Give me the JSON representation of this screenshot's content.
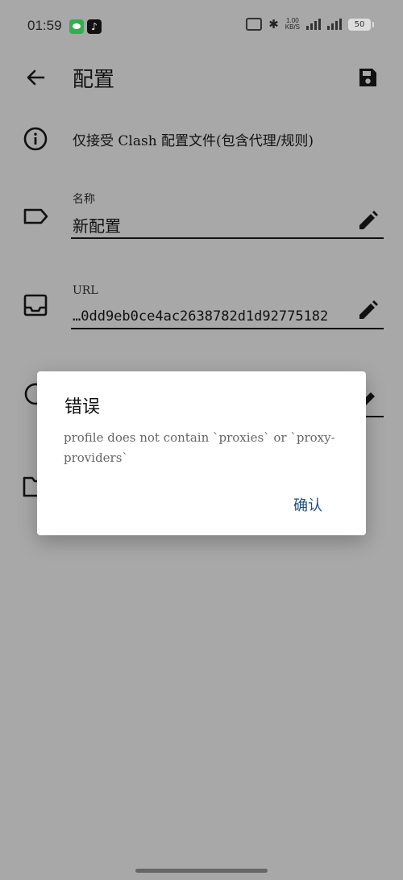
{
  "status_bar": {
    "time": "01:59",
    "net_speed_value": "1.00",
    "net_speed_unit": "KB/S",
    "battery": "50",
    "icons": [
      "wechat-icon",
      "tiktok-icon",
      "vibrate-icon",
      "bluetooth-icon",
      "signal-icon",
      "signal-icon",
      "battery-icon"
    ]
  },
  "app_bar": {
    "title": "配置",
    "back_icon": "arrow-back-icon",
    "save_icon": "save-icon"
  },
  "info": {
    "text": "仅接受 Clash 配置文件(包含代理/规则)"
  },
  "name_field": {
    "label": "名称",
    "value": "新配置"
  },
  "url_field": {
    "label": "URL",
    "value": "…0dd9eb0ce4ac2638782d1d92775182"
  },
  "dialog": {
    "title": "错误",
    "message": "profile does not contain `proxies` or `proxy-providers`",
    "ok_label": "确认"
  }
}
